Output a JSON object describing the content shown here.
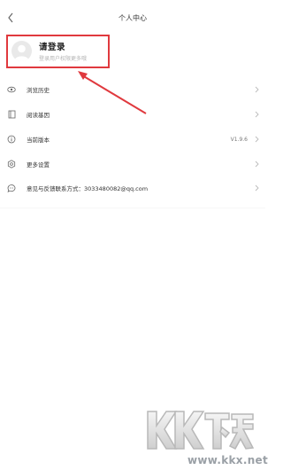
{
  "header": {
    "title": "个人中心",
    "back_icon": "chevron-left-icon"
  },
  "profile": {
    "title": "请登录",
    "subtitle": "登录用户权限更多哦",
    "avatar_icon": "default-avatar-icon",
    "highlight_color": "#e0393e"
  },
  "menu": {
    "items": [
      {
        "label": "浏览历史",
        "icon": "eye-icon",
        "value": ""
      },
      {
        "label": "阅读基因",
        "icon": "book-icon",
        "value": ""
      },
      {
        "label": "当前版本",
        "icon": "info-icon",
        "value": "V1.9.6"
      },
      {
        "label": "更多设置",
        "icon": "settings-icon",
        "value": ""
      },
      {
        "label": "意见与反馈联系方式：3033480082@qq.com",
        "icon": "message-icon",
        "value": ""
      }
    ]
  },
  "watermark": {
    "url": "www.kkx.net",
    "logo_text": "KK下载"
  }
}
